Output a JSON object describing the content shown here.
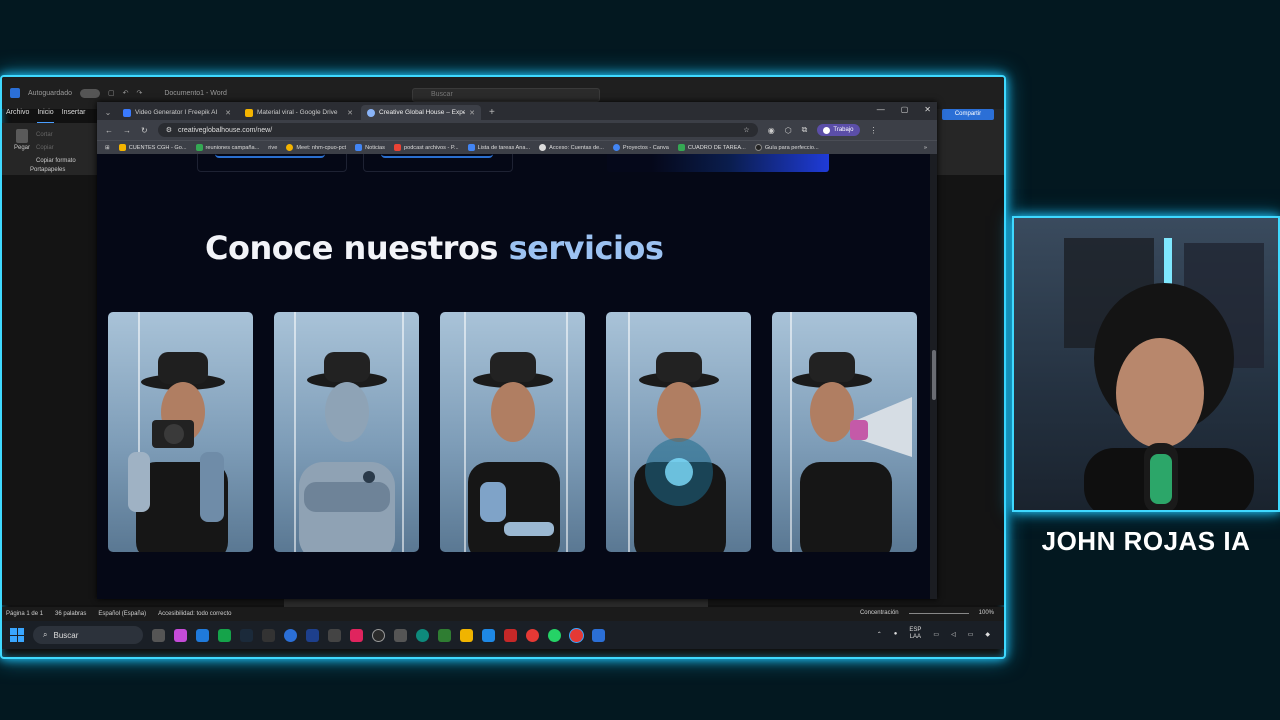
{
  "word": {
    "autosave": "Autoguardado",
    "doc_title": "Documento1 - Word",
    "search": "Buscar",
    "tabs": [
      "Archivo",
      "Inicio",
      "Insertar"
    ],
    "ribbon": {
      "paste": "Pegar",
      "cut": "Cortar",
      "copy": "Copiar",
      "format": "Copiar formato",
      "group": "Portapapeles"
    },
    "share": "Compartir",
    "status": {
      "page": "Página 1 de 1",
      "words": "36 palabras",
      "lang": "Español (España)",
      "access": "Accesibilidad: todo correcto",
      "focus": "Concentración",
      "zoom": "100%"
    }
  },
  "taskbar": {
    "search": "Buscar",
    "lang_top": "ESP",
    "lang_bottom": "LAA"
  },
  "chrome": {
    "tabs": [
      {
        "label": "Video Generator I Freepik AI",
        "color": "#3a7afe"
      },
      {
        "label": "Material viral - Google Drive",
        "color": "#f4b400"
      },
      {
        "label": "Creative Global House – Experi",
        "color": "#8ab4f8"
      }
    ],
    "url": "creativeglobalhouse.com/new/",
    "profile": "Trabajo",
    "bookmarks": [
      {
        "label": "CUENTES CGH - Go...",
        "color": "#f4b400"
      },
      {
        "label": "reuniones campaña...",
        "color": "#34a853"
      },
      {
        "label": "rive",
        "color": ""
      },
      {
        "label": "Meet: nhm-cpuo-pct",
        "color": "#f4b400"
      },
      {
        "label": "Noticias",
        "color": "#4285f4"
      },
      {
        "label": "podcast archivos - P...",
        "color": "#ea4335"
      },
      {
        "label": "Lista de tareas Ana...",
        "color": "#4285f4"
      },
      {
        "label": "Acceso: Cuentas de...",
        "color": "#dddddd"
      },
      {
        "label": "Proyectos - Canva",
        "color": "#4285f4"
      },
      {
        "label": "CUADRO DE TAREA...",
        "color": "#34a853"
      },
      {
        "label": "Guía para perfeccio...",
        "color": "#222222"
      }
    ]
  },
  "page": {
    "heading_main": "Conoce nuestros ",
    "heading_accent": "servicios"
  },
  "webcam": {
    "name": "JOHN ROJAS IA"
  },
  "colors": {
    "accent": "#9cc2f2",
    "neon": "#3fd9ff"
  }
}
